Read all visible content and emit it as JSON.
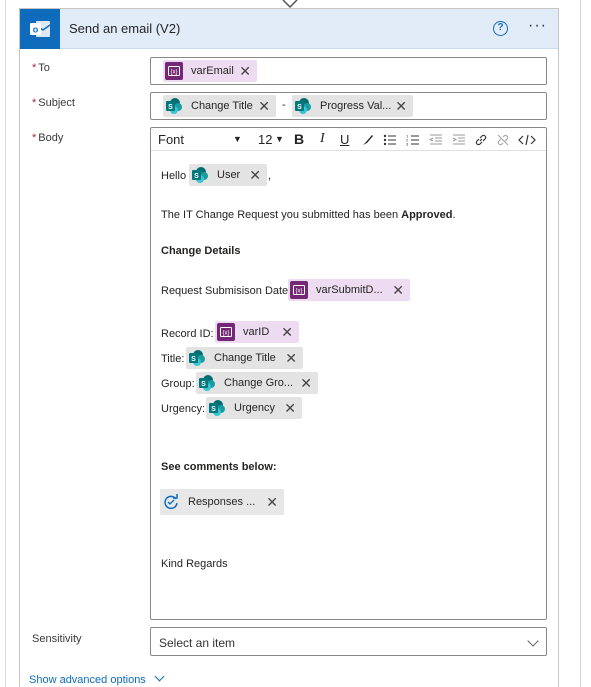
{
  "header": {
    "title": "Send an email (V2)",
    "help_icon": "question-circle-icon",
    "more_icon": "ellipsis-icon"
  },
  "fields": {
    "to_label": "To",
    "subject_label": "Subject",
    "body_label": "Body",
    "sensitivity_label": "Sensitivity",
    "required_marker": "*"
  },
  "to_tokens": [
    {
      "label": "varEmail",
      "icon": "variable-icon"
    }
  ],
  "subject_tokens": [
    {
      "label": "Change Title",
      "icon": "sharepoint-icon"
    },
    {
      "label": "Progress Val...",
      "icon": "sharepoint-icon"
    }
  ],
  "subject_separator": "-",
  "toolbar": {
    "font": "Font",
    "size": "12",
    "bold": "B",
    "italic": "I",
    "underline": "U"
  },
  "body": {
    "hello": "Hello",
    "user_token": "User",
    "comma": ",",
    "sentence_start": "The IT Change Request you submitted has been",
    "approved": "Approved",
    "period": ".",
    "change_details": "Change Details",
    "request_date_label": "Request Submisison Date:",
    "request_date_token": "varSubmitD...",
    "record_label": "Record ID:",
    "record_token": "varID",
    "title_label": "Title:",
    "title_token": "Change Title",
    "group_label": "Group:",
    "group_token": "Change Gro...",
    "urgency_label": "Urgency:",
    "urgency_token": "Urgency",
    "comments": "See comments below:",
    "responses_token": "Responses ...",
    "regards": "Kind Regards"
  },
  "sensitivity": {
    "placeholder": "Select an item"
  },
  "advanced": {
    "label": "Show advanced options"
  },
  "colors": {
    "accent": "#0f6cbd",
    "variable": "#742774",
    "sharepoint": "#038387",
    "required": "#a4262c"
  }
}
